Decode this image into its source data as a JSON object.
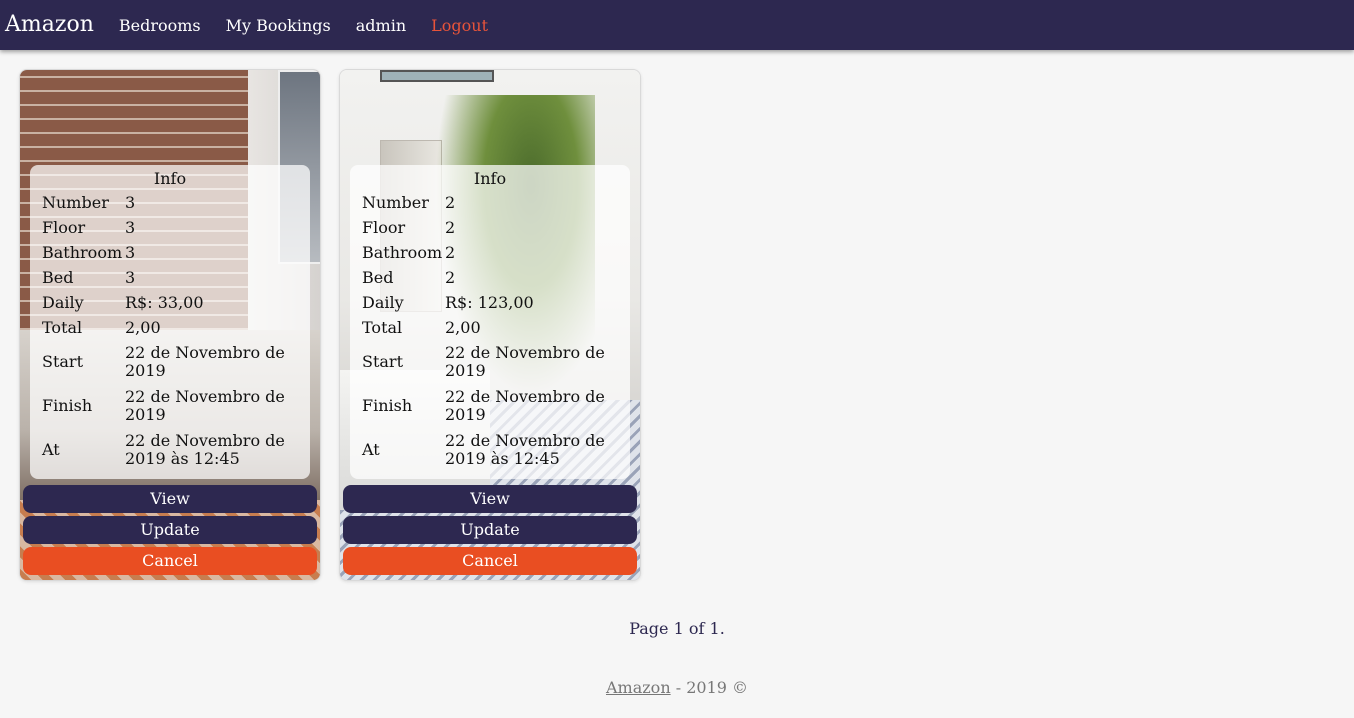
{
  "nav": {
    "brand": "Amazon",
    "links": [
      "Bedrooms",
      "My Bookings",
      "admin"
    ],
    "logout": "Logout"
  },
  "info_title": "Info",
  "labels": {
    "number": "Number",
    "floor": "Floor",
    "bathroom": "Bathroom",
    "bed": "Bed",
    "daily": "Daily",
    "total": "Total",
    "start": "Start",
    "finish": "Finish",
    "at": "At"
  },
  "buttons": {
    "view": "View",
    "update": "Update",
    "cancel": "Cancel"
  },
  "bookings": [
    {
      "number": "3",
      "floor": "3",
      "bathroom": "3",
      "bed": "3",
      "daily": "R$: 33,00",
      "total": "2,00",
      "start": "22 de Novembro de 2019",
      "finish": "22 de Novembro de 2019",
      "at": "22 de Novembro de 2019 às 12:45"
    },
    {
      "number": "2",
      "floor": "2",
      "bathroom": "2",
      "bed": "2",
      "daily": "R$: 123,00",
      "total": "2,00",
      "start": "22 de Novembro de 2019",
      "finish": "22 de Novembro de 2019",
      "at": "22 de Novembro de 2019 às 12:45"
    }
  ],
  "pagination": "Page 1 of 1.",
  "footer": {
    "link": "Amazon",
    "text": " - 2019 ©"
  },
  "colors": {
    "navbar": "#2d2850",
    "logout": "#e8543a",
    "button_dark": "#2d2850",
    "button_cancel": "#e94e22"
  }
}
